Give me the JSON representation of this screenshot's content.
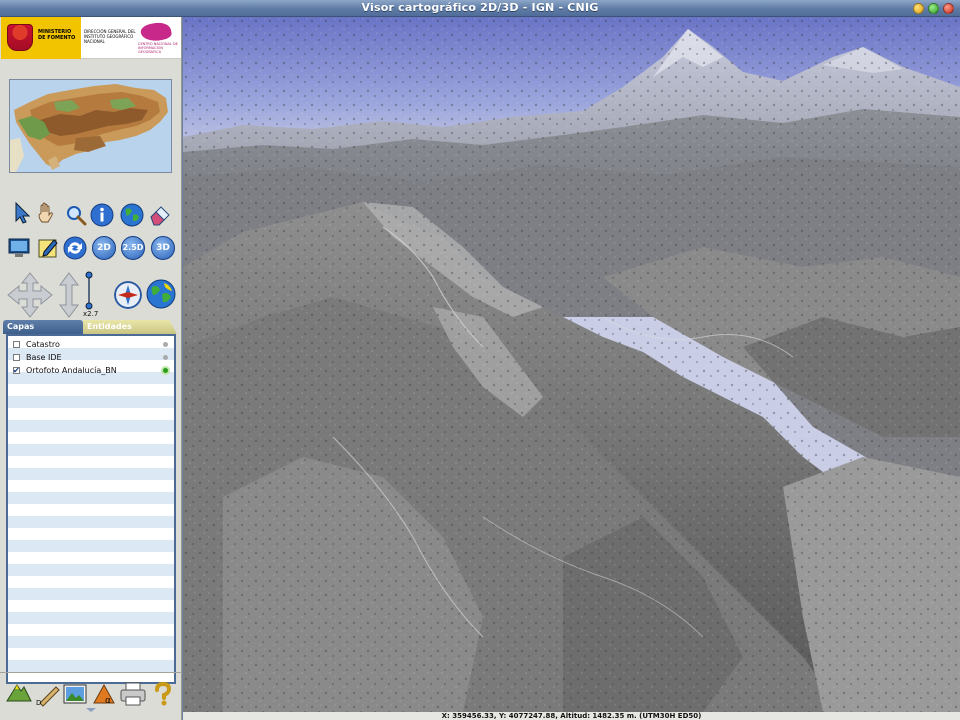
{
  "window": {
    "title": "Visor cartográfico 2D/3D - IGN - CNIG"
  },
  "logos": {
    "ministerio": "MINISTERIO DE FOMENTO",
    "direccion": "DIRECCIÓN GENERAL DEL INSTITUTO GEOGRÁFICO NACIONAL",
    "cnig": "CENTRO NACIONAL DE INFORMACIÓN GEOGRÁFICA"
  },
  "toolbar": {
    "row1": [
      "select-arrow-icon",
      "pan-hand-icon",
      "zoom-magnifier-icon",
      "info-icon",
      "globe-icon",
      "eraser-icon"
    ],
    "row2": [
      "monitor-icon",
      "edit-map-icon",
      "refresh-icon"
    ],
    "view_modes": [
      "2D",
      "2.5D",
      "3D"
    ],
    "exaggeration": "x2.7"
  },
  "tabs": [
    {
      "label": "Capas",
      "active": true
    },
    {
      "label": "Entidades",
      "active": false
    }
  ],
  "layers": [
    {
      "name": "Catastro",
      "checked": false,
      "active": false
    },
    {
      "name": "Base IDE",
      "checked": false,
      "active": false
    },
    {
      "name": "Ortofoto Andalucía_BN",
      "checked": true,
      "active": true
    }
  ],
  "bottom_tools": [
    "terrain-icon",
    "ruler-icon",
    "photo-icon",
    "alpha-icon",
    "print-icon",
    "help-icon"
  ],
  "status": {
    "coordinates": "X: 359456.33,  Y: 4077247.88,  Altitud: 1482.35 m.  (UTM30H ED50)"
  },
  "colors": {
    "title_bar": "#5f7ca6",
    "panel_bg": "#dcdcd6",
    "tab_active": "#3e5e8c",
    "tab_inactive": "#c9c482",
    "sky_top": "#6f79c9"
  }
}
